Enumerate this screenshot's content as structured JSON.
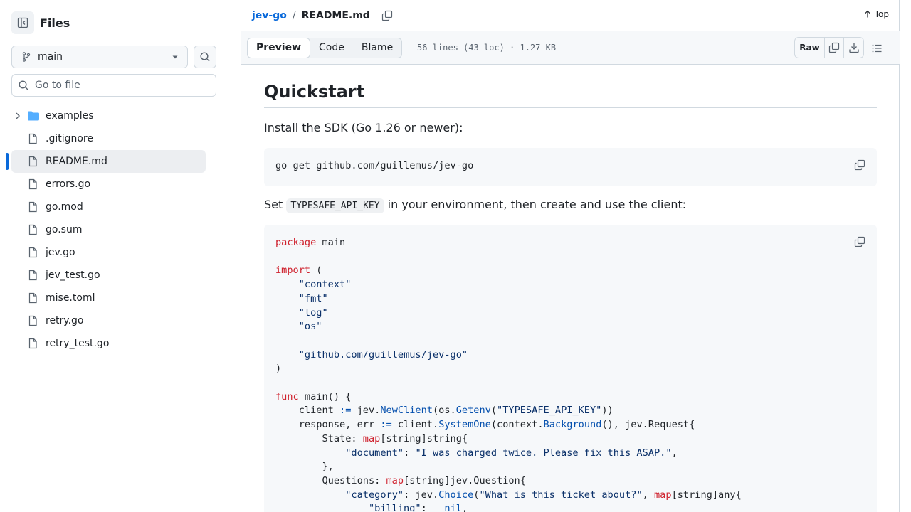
{
  "sidebar": {
    "title": "Files",
    "branch": "main",
    "goto_placeholder": "Go to file",
    "items": [
      {
        "name": "examples",
        "type": "folder"
      },
      {
        "name": ".gitignore",
        "type": "file"
      },
      {
        "name": "README.md",
        "type": "file",
        "active": true
      },
      {
        "name": "errors.go",
        "type": "file"
      },
      {
        "name": "go.mod",
        "type": "file"
      },
      {
        "name": "go.sum",
        "type": "file"
      },
      {
        "name": "jev.go",
        "type": "file"
      },
      {
        "name": "jev_test.go",
        "type": "file"
      },
      {
        "name": "mise.toml",
        "type": "file"
      },
      {
        "name": "retry.go",
        "type": "file"
      },
      {
        "name": "retry_test.go",
        "type": "file"
      }
    ]
  },
  "header": {
    "repo": "jev-go",
    "separator": "/",
    "file": "README.md",
    "top_label": "Top"
  },
  "filebar": {
    "tabs": [
      "Preview",
      "Code",
      "Blame"
    ],
    "info": "56 lines (43 loc) · 1.27 KB",
    "raw_label": "Raw"
  },
  "readme": {
    "heading": "Quickstart",
    "install_text": "Install the SDK (Go 1.26 or newer):",
    "install_cmd": "go get github.com/guillemus/jev-go",
    "set_prefix": "Set ",
    "env_var": "TYPESAFE_API_KEY",
    "set_suffix": " in your environment, then create and use the client:"
  },
  "colors": {
    "accent": "#0969da",
    "keyword": "#cf222e",
    "string": "#0a3069",
    "function": "#0550ae"
  }
}
